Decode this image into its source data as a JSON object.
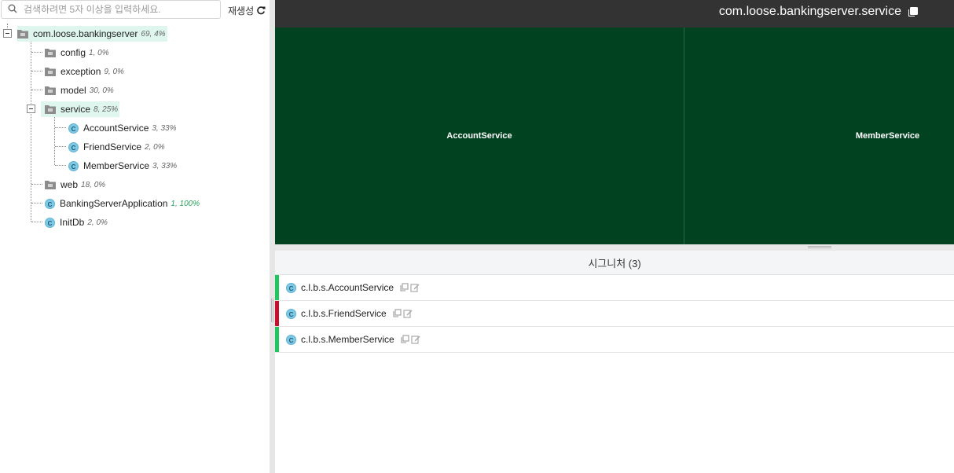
{
  "search": {
    "placeholder": "검색하려면 5자 이상을 입력하세요.",
    "value": ""
  },
  "regenerate": {
    "label": "재생성",
    "icon": "refresh-icon"
  },
  "tree": {
    "root": {
      "label": "com.loose.bankingserver",
      "meta": "69, 4%"
    },
    "items": [
      {
        "label": "config",
        "meta": "1, 0%"
      },
      {
        "label": "exception",
        "meta": "9, 0%"
      },
      {
        "label": "model",
        "meta": "30, 0%"
      },
      {
        "label": "service",
        "meta": "8, 25%"
      },
      {
        "label": "AccountService",
        "meta": "3, 33%"
      },
      {
        "label": "FriendService",
        "meta": "2, 0%"
      },
      {
        "label": "MemberService",
        "meta": "3, 33%"
      },
      {
        "label": "web",
        "meta": "18, 0%"
      },
      {
        "label": "BankingServerApplication",
        "meta": "1, 100%"
      },
      {
        "label": "InitDb",
        "meta": "2, 0%"
      }
    ]
  },
  "header": {
    "title": "com.loose.bankingserver.service"
  },
  "treemap": {
    "cells": [
      {
        "label": "AccountService"
      },
      {
        "label": "MemberService"
      }
    ],
    "color": "#014320"
  },
  "signatures": {
    "title": "시그니처 (3)",
    "rows": [
      {
        "label": "c.l.b.s.AccountService",
        "status_color": "#1fc75e"
      },
      {
        "label": "c.l.b.s.FriendService",
        "status_color": "#c8102e"
      },
      {
        "label": "c.l.b.s.MemberService",
        "status_color": "#1fc75e"
      }
    ]
  },
  "colors": {
    "topbar": "#333333",
    "highlight": "#dff6ef",
    "class_icon": "#7ec8e3"
  }
}
